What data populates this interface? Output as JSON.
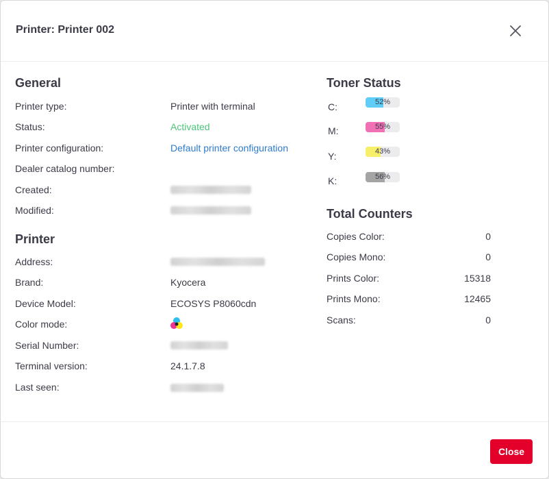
{
  "header": {
    "title": "Printer: Printer 002"
  },
  "general": {
    "title": "General",
    "rows": [
      {
        "label": "Printer type:",
        "value": "Printer with terminal"
      },
      {
        "label": "Status:",
        "value": "Activated"
      },
      {
        "label": "Printer configuration:",
        "value": "Default printer configuration"
      },
      {
        "label": "Dealer catalog number:",
        "value": ""
      },
      {
        "label": "Created:",
        "value": ""
      },
      {
        "label": "Modified:",
        "value": ""
      }
    ]
  },
  "printer": {
    "title": "Printer",
    "rows": [
      {
        "label": "Address:",
        "value": ""
      },
      {
        "label": "Brand:",
        "value": "Kyocera"
      },
      {
        "label": "Device Model:",
        "value": "ECOSYS P8060cdn"
      },
      {
        "label": "Color mode:",
        "value": ""
      },
      {
        "label": "Serial Number:",
        "value": ""
      },
      {
        "label": "Terminal version:",
        "value": "24.1.7.8"
      },
      {
        "label": "Last seen:",
        "value": ""
      }
    ]
  },
  "toner": {
    "title": "Toner Status",
    "items": [
      {
        "label": "C:",
        "percent": 52,
        "percent_text": "52%",
        "color": "#5fcdf5"
      },
      {
        "label": "M:",
        "percent": 55,
        "percent_text": "55%",
        "color": "#f06fb5"
      },
      {
        "label": "Y:",
        "percent": 43,
        "percent_text": "43%",
        "color": "#f7ef6a"
      },
      {
        "label": "K:",
        "percent": 56,
        "percent_text": "56%",
        "color": "#a4a4a4"
      }
    ]
  },
  "counters": {
    "title": "Total Counters",
    "rows": [
      {
        "label": "Copies Color:",
        "value": "0"
      },
      {
        "label": "Copies Mono:",
        "value": "0"
      },
      {
        "label": "Prints Color:",
        "value": "15318"
      },
      {
        "label": "Prints Mono:",
        "value": "12465"
      },
      {
        "label": "Scans:",
        "value": "0"
      }
    ]
  },
  "footer": {
    "close_label": "Close"
  },
  "colors": {
    "status_active": "#4cc47a",
    "link": "#2e7bcf",
    "primary_button": "#e3002b"
  },
  "icons": {
    "close": "close-icon",
    "color_mode": "cmyk-color-icon"
  }
}
